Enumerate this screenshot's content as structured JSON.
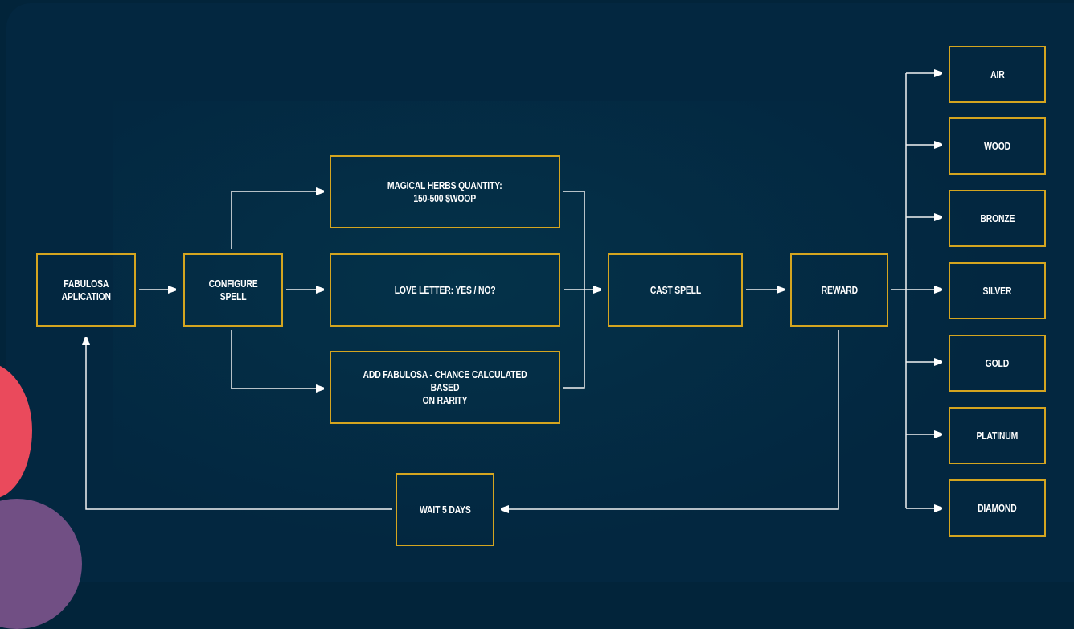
{
  "diagram": {
    "nodes": [
      {
        "id": "fabulosa-application",
        "label": "FABULOSA\nAPLICATION"
      },
      {
        "id": "configure-spell",
        "label": "CONFIGURE\nSPELL"
      },
      {
        "id": "magical-herbs",
        "label": "MAGICAL HERBS QUANTITY:\n150-500 $WOOP"
      },
      {
        "id": "love-letter",
        "label": "LOVE LETTER: YES / NO?"
      },
      {
        "id": "add-fabulosa",
        "label": "ADD FABULOSA - CHANCE CALCULATED BASED\nON RARITY"
      },
      {
        "id": "cast-spell",
        "label": "CAST SPELL"
      },
      {
        "id": "reward",
        "label": "REWARD"
      },
      {
        "id": "wait",
        "label": "WAIT 5 DAYS"
      },
      {
        "id": "air",
        "label": "AIR"
      },
      {
        "id": "wood",
        "label": "WOOD"
      },
      {
        "id": "bronze",
        "label": "BRONZE"
      },
      {
        "id": "silver",
        "label": "SILVER"
      },
      {
        "id": "gold",
        "label": "GOLD"
      },
      {
        "id": "platinum",
        "label": "PLATINUM"
      },
      {
        "id": "diamond",
        "label": "DIAMOND"
      }
    ],
    "edges": [
      {
        "from": "fabulosa-application",
        "to": "configure-spell"
      },
      {
        "from": "configure-spell",
        "to": "magical-herbs"
      },
      {
        "from": "configure-spell",
        "to": "love-letter"
      },
      {
        "from": "configure-spell",
        "to": "add-fabulosa"
      },
      {
        "from": "magical-herbs",
        "to": "cast-spell"
      },
      {
        "from": "love-letter",
        "to": "cast-spell"
      },
      {
        "from": "add-fabulosa",
        "to": "cast-spell"
      },
      {
        "from": "cast-spell",
        "to": "reward"
      },
      {
        "from": "reward",
        "to": "air"
      },
      {
        "from": "reward",
        "to": "wood"
      },
      {
        "from": "reward",
        "to": "bronze"
      },
      {
        "from": "reward",
        "to": "silver"
      },
      {
        "from": "reward",
        "to": "gold"
      },
      {
        "from": "reward",
        "to": "platinum"
      },
      {
        "from": "reward",
        "to": "diamond"
      },
      {
        "from": "reward",
        "to": "wait"
      },
      {
        "from": "wait",
        "to": "fabulosa-application"
      }
    ]
  },
  "colors": {
    "background": "#032740",
    "box_border": "#d4a520",
    "text": "#ffffff",
    "connector": "#ffffff",
    "accent_red": "#ea4a5c",
    "accent_purple": "#714f84"
  }
}
